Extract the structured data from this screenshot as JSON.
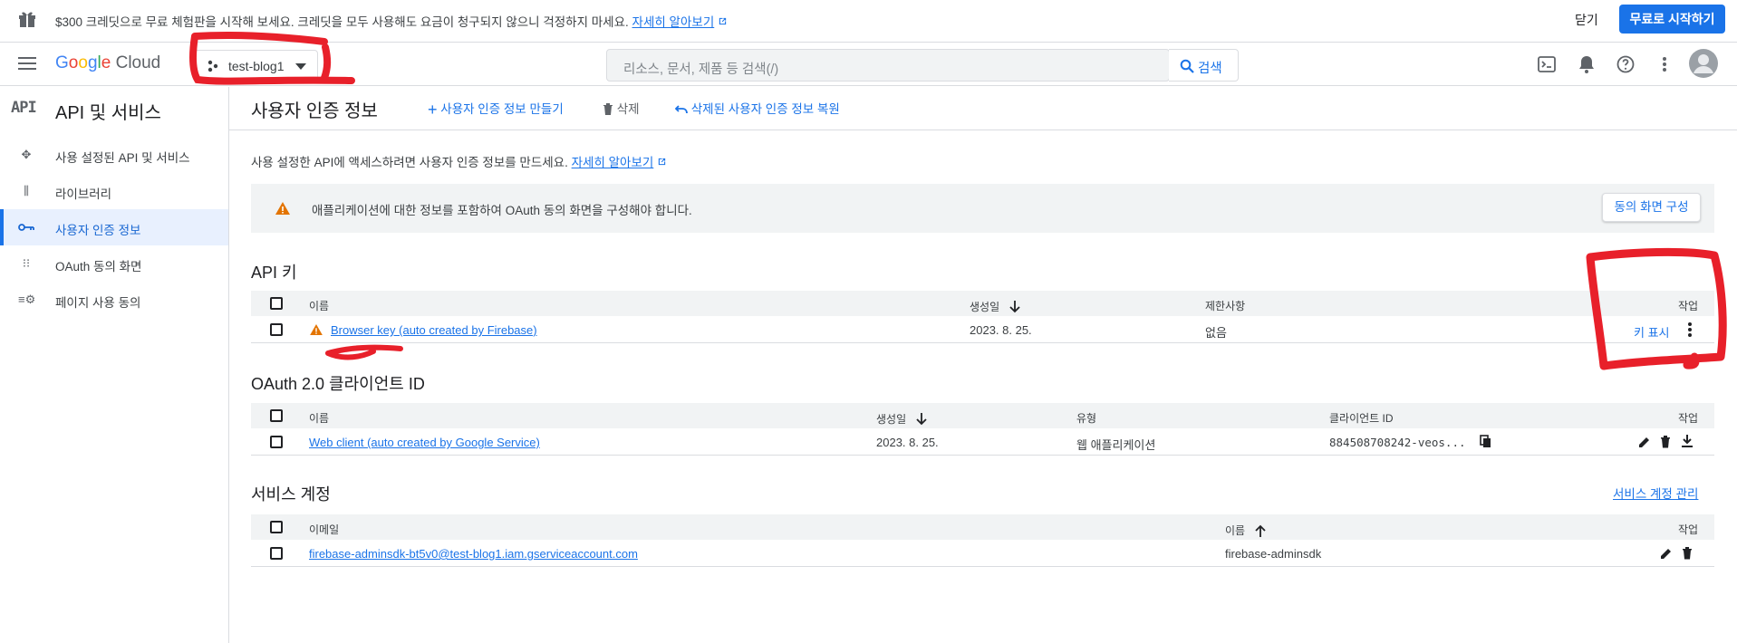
{
  "promo": {
    "message": "$300 크레딧으로 무료 체험판을 시작해 보세요. 크레딧을 모두 사용해도 요금이 청구되지 않으니 걱정하지 마세요.",
    "learn_more": "자세히 알아보기",
    "close_label": "닫기",
    "start_label": "무료로 시작하기"
  },
  "header": {
    "brand": "Google Cloud",
    "project": "test-blog1",
    "search_placeholder": "리소스, 문서, 제품 등 검색(/)",
    "search_button": "검색"
  },
  "sidebar": {
    "title": "API 및 서비스",
    "items": [
      {
        "label": "사용 설정된 API 및 서비스",
        "icon": "enabled-apis-icon"
      },
      {
        "label": "라이브러리",
        "icon": "library-icon"
      },
      {
        "label": "사용자 인증 정보",
        "icon": "key-icon",
        "active": true
      },
      {
        "label": "OAuth 동의 화면",
        "icon": "consent-icon"
      },
      {
        "label": "페이지 사용 동의",
        "icon": "page-consent-icon"
      }
    ]
  },
  "page": {
    "title": "사용자 인증 정보",
    "create_label": "사용자 인증 정보 만들기",
    "delete_label": "삭제",
    "restore_label": "삭제된 사용자 인증 정보 복원",
    "description": "사용 설정한 API에 액세스하려면 사용자 인증 정보를 만드세요.",
    "description_link": "자세히 알아보기",
    "banner_message": "애플리케이션에 대한 정보를 포함하여 OAuth 동의 화면을 구성해야 합니다.",
    "banner_button": "동의 화면 구성"
  },
  "api_keys": {
    "title": "API 키",
    "columns": {
      "name": "이름",
      "created": "생성일",
      "restrictions": "제한사항",
      "actions": "작업"
    },
    "rows": [
      {
        "name": "Browser key (auto created by Firebase)",
        "created": "2023. 8. 25.",
        "restrictions": "없음",
        "action": "키 표시"
      }
    ]
  },
  "oauth": {
    "title": "OAuth 2.0 클라이언트 ID",
    "columns": {
      "name": "이름",
      "created": "생성일",
      "type": "유형",
      "client_id": "클라이언트 ID",
      "actions": "작업"
    },
    "rows": [
      {
        "name": "Web client (auto created by Google Service)",
        "created": "2023. 8. 25.",
        "type": "웹 애플리케이션",
        "client_id": "884508708242-veos..."
      }
    ]
  },
  "service_accounts": {
    "title": "서비스 계정",
    "manage_label": "서비스 계정 관리",
    "columns": {
      "email": "이메일",
      "name": "이름",
      "actions": "작업"
    },
    "rows": [
      {
        "email": "firebase-adminsdk-bt5v0@test-blog1.iam.gserviceaccount.com",
        "name": "firebase-adminsdk"
      }
    ]
  },
  "colors": {
    "accent": "#1a73e8",
    "annotation": "#e8202a",
    "warning": "#e37400"
  }
}
